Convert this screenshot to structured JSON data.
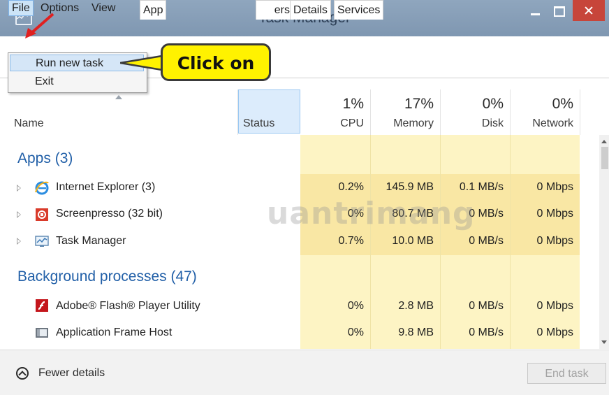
{
  "window": {
    "title": "Task Manager"
  },
  "menu": {
    "file": "File",
    "options": "Options",
    "view": "View"
  },
  "file_menu": {
    "items": [
      {
        "label": "Run new task"
      },
      {
        "label": "Exit"
      }
    ]
  },
  "callout": {
    "text": "Click on"
  },
  "tabs": [
    {
      "label": "App"
    },
    {
      "label": "ers"
    },
    {
      "label": "Details"
    },
    {
      "label": "Services"
    }
  ],
  "columns": {
    "name": "Name",
    "status": "Status",
    "cpu": {
      "percent": "1%",
      "label": "CPU"
    },
    "memory": {
      "percent": "17%",
      "label": "Memory"
    },
    "disk": {
      "percent": "0%",
      "label": "Disk"
    },
    "network": {
      "percent": "0%",
      "label": "Network"
    }
  },
  "sections": {
    "apps": {
      "title": "Apps (3)",
      "rows": [
        {
          "name": "Internet Explorer (3)",
          "icon": "internet-explorer-icon",
          "cpu": "0.2%",
          "memory": "145.9 MB",
          "disk": "0.1 MB/s",
          "network": "0 Mbps"
        },
        {
          "name": "Screenpresso (32 bit)",
          "icon": "screenpresso-icon",
          "cpu": "0%",
          "memory": "80.7 MB",
          "disk": "0 MB/s",
          "network": "0 Mbps"
        },
        {
          "name": "Task Manager",
          "icon": "task-manager-icon",
          "cpu": "0.7%",
          "memory": "10.0 MB",
          "disk": "0 MB/s",
          "network": "0 Mbps"
        }
      ]
    },
    "background": {
      "title": "Background processes (47)",
      "rows": [
        {
          "name": "Adobe® Flash® Player Utility",
          "icon": "flash-player-icon",
          "cpu": "0%",
          "memory": "2.8 MB",
          "disk": "0 MB/s",
          "network": "0 Mbps"
        },
        {
          "name": "Application Frame Host",
          "icon": "application-frame-icon",
          "cpu": "0%",
          "memory": "9.8 MB",
          "disk": "0 MB/s",
          "network": "0 Mbps"
        }
      ]
    }
  },
  "footer": {
    "fewer_details": "Fewer details",
    "end_task": "End task"
  },
  "watermark": {
    "text": "uantrimang"
  },
  "colors": {
    "titlebar": "#8fa6be",
    "close": "#c7453a",
    "section": "#2260a8",
    "highlight": "#fdf4c4",
    "callout": "#fff200",
    "arrow": "#e02020"
  }
}
